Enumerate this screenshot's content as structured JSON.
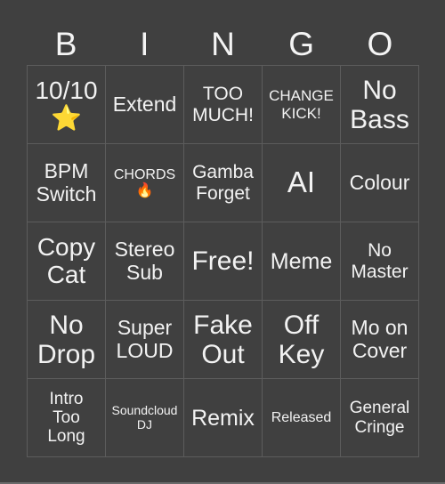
{
  "header": {
    "letters": [
      "B",
      "I",
      "N",
      "G",
      "O"
    ]
  },
  "board": {
    "rows": [
      [
        "10/10\n⭐",
        "Extend",
        "TOO\nMUCH!",
        "CHANGE\nKICK!",
        "No\nBass"
      ],
      [
        "BPM\nSwitch",
        "CHORDS\n🔥",
        "Gamba\nForget",
        "AI",
        "Colour"
      ],
      [
        "Copy\nCat",
        "Stereo\nSub",
        "Free!",
        "Meme",
        "No\nMaster"
      ],
      [
        "No\nDrop",
        "Super\nLOUD",
        "Fake\nOut",
        "Off\nKey",
        "Mo on\nCover"
      ],
      [
        "Intro\nToo\nLong",
        "Soundcloud\nDJ",
        "Remix",
        "Released",
        "General\nCringe"
      ]
    ]
  },
  "colors": {
    "background": "#404040",
    "grid_line": "#5c5c5c",
    "text": "#f2f2f2"
  }
}
